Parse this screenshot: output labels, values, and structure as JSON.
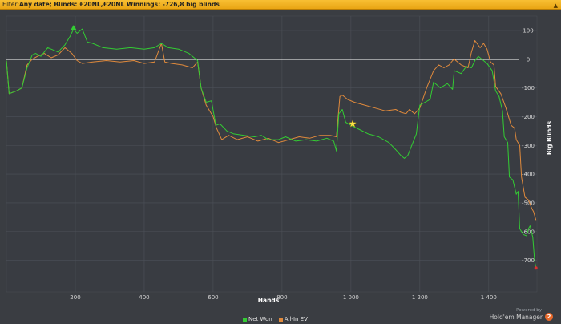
{
  "filter": {
    "prefix": "Filter:",
    "text": "Any date; Blinds: £20NL,£20NL Winnings: -726,8 big blinds"
  },
  "chart_data": {
    "type": "line",
    "title": "",
    "xlabel": "Hands",
    "ylabel": "Big Blinds",
    "xlim": [
      0,
      1540
    ],
    "ylim": [
      -810,
      150
    ],
    "x_ticks": [
      200,
      400,
      600,
      800,
      1000,
      1200,
      1400
    ],
    "x_tick_labels": [
      "200",
      "400",
      "600",
      "800",
      "1 000",
      "1 200",
      "1 400"
    ],
    "y_ticks": [
      100,
      0,
      -100,
      -200,
      -300,
      -400,
      -500,
      -600,
      -700
    ],
    "y_tick_labels": [
      "100",
      "0",
      "-100",
      "-200",
      "-300",
      "-400",
      "-500",
      "-600",
      "-700"
    ],
    "zero_line": 0,
    "grid": true,
    "legend_position": "bottom-center",
    "series": [
      {
        "name": "Net Won",
        "color": "#33cc33",
        "points": [
          [
            0,
            -5
          ],
          [
            8,
            -120
          ],
          [
            30,
            -110
          ],
          [
            45,
            -100
          ],
          [
            60,
            -30
          ],
          [
            75,
            15
          ],
          [
            85,
            20
          ],
          [
            100,
            10
          ],
          [
            120,
            40
          ],
          [
            150,
            25
          ],
          [
            170,
            50
          ],
          [
            185,
            80
          ],
          [
            195,
            105
          ],
          [
            205,
            90
          ],
          [
            220,
            105
          ],
          [
            235,
            60
          ],
          [
            250,
            55
          ],
          [
            280,
            40
          ],
          [
            320,
            35
          ],
          [
            360,
            40
          ],
          [
            400,
            35
          ],
          [
            430,
            40
          ],
          [
            450,
            55
          ],
          [
            470,
            40
          ],
          [
            500,
            35
          ],
          [
            530,
            20
          ],
          [
            555,
            -5
          ],
          [
            565,
            -100
          ],
          [
            580,
            -150
          ],
          [
            595,
            -145
          ],
          [
            608,
            -230
          ],
          [
            620,
            -225
          ],
          [
            640,
            -250
          ],
          [
            660,
            -260
          ],
          [
            690,
            -265
          ],
          [
            720,
            -270
          ],
          [
            740,
            -265
          ],
          [
            760,
            -280
          ],
          [
            790,
            -280
          ],
          [
            810,
            -270
          ],
          [
            840,
            -285
          ],
          [
            870,
            -280
          ],
          [
            900,
            -285
          ],
          [
            930,
            -275
          ],
          [
            950,
            -285
          ],
          [
            958,
            -320
          ],
          [
            965,
            -190
          ],
          [
            975,
            -175
          ],
          [
            985,
            -220
          ],
          [
            1000,
            -230
          ],
          [
            1025,
            -245
          ],
          [
            1050,
            -260
          ],
          [
            1080,
            -270
          ],
          [
            1110,
            -290
          ],
          [
            1130,
            -315
          ],
          [
            1145,
            -335
          ],
          [
            1155,
            -345
          ],
          [
            1165,
            -335
          ],
          [
            1180,
            -290
          ],
          [
            1190,
            -260
          ],
          [
            1200,
            -160
          ],
          [
            1215,
            -150
          ],
          [
            1230,
            -140
          ],
          [
            1240,
            -80
          ],
          [
            1260,
            -100
          ],
          [
            1280,
            -85
          ],
          [
            1295,
            -105
          ],
          [
            1300,
            -40
          ],
          [
            1320,
            -50
          ],
          [
            1335,
            -25
          ],
          [
            1350,
            -30
          ],
          [
            1360,
            -5
          ],
          [
            1370,
            10
          ],
          [
            1380,
            0
          ],
          [
            1395,
            -15
          ],
          [
            1410,
            -40
          ],
          [
            1420,
            -110
          ],
          [
            1430,
            -130
          ],
          [
            1440,
            -180
          ],
          [
            1445,
            -270
          ],
          [
            1455,
            -290
          ],
          [
            1460,
            -410
          ],
          [
            1470,
            -420
          ],
          [
            1480,
            -470
          ],
          [
            1485,
            -460
          ],
          [
            1490,
            -590
          ],
          [
            1495,
            -600
          ],
          [
            1500,
            -610
          ],
          [
            1510,
            -615
          ],
          [
            1515,
            -590
          ],
          [
            1520,
            -580
          ],
          [
            1528,
            -620
          ],
          [
            1533,
            -700
          ],
          [
            1537,
            -727
          ]
        ]
      },
      {
        "name": "All-In EV",
        "color": "#e08a3c",
        "points": [
          [
            0,
            -5
          ],
          [
            8,
            -120
          ],
          [
            30,
            -110
          ],
          [
            45,
            -100
          ],
          [
            60,
            -20
          ],
          [
            75,
            0
          ],
          [
            90,
            10
          ],
          [
            110,
            20
          ],
          [
            130,
            5
          ],
          [
            150,
            15
          ],
          [
            170,
            40
          ],
          [
            190,
            20
          ],
          [
            205,
            -5
          ],
          [
            220,
            -15
          ],
          [
            250,
            -10
          ],
          [
            290,
            -5
          ],
          [
            330,
            -10
          ],
          [
            370,
            -5
          ],
          [
            400,
            -15
          ],
          [
            430,
            -10
          ],
          [
            450,
            55
          ],
          [
            460,
            -10
          ],
          [
            480,
            -15
          ],
          [
            510,
            -20
          ],
          [
            540,
            -30
          ],
          [
            555,
            -10
          ],
          [
            565,
            -100
          ],
          [
            580,
            -160
          ],
          [
            600,
            -200
          ],
          [
            610,
            -240
          ],
          [
            625,
            -280
          ],
          [
            645,
            -265
          ],
          [
            670,
            -280
          ],
          [
            700,
            -270
          ],
          [
            730,
            -285
          ],
          [
            760,
            -275
          ],
          [
            790,
            -290
          ],
          [
            820,
            -280
          ],
          [
            850,
            -270
          ],
          [
            880,
            -275
          ],
          [
            910,
            -265
          ],
          [
            940,
            -265
          ],
          [
            958,
            -270
          ],
          [
            968,
            -130
          ],
          [
            975,
            -125
          ],
          [
            990,
            -140
          ],
          [
            1010,
            -150
          ],
          [
            1040,
            -160
          ],
          [
            1070,
            -170
          ],
          [
            1100,
            -180
          ],
          [
            1130,
            -175
          ],
          [
            1145,
            -185
          ],
          [
            1160,
            -190
          ],
          [
            1170,
            -175
          ],
          [
            1185,
            -190
          ],
          [
            1200,
            -170
          ],
          [
            1220,
            -100
          ],
          [
            1240,
            -40
          ],
          [
            1255,
            -20
          ],
          [
            1270,
            -30
          ],
          [
            1285,
            -20
          ],
          [
            1295,
            -5
          ],
          [
            1300,
            0
          ],
          [
            1320,
            -20
          ],
          [
            1340,
            -30
          ],
          [
            1350,
            25
          ],
          [
            1360,
            65
          ],
          [
            1375,
            40
          ],
          [
            1385,
            55
          ],
          [
            1395,
            35
          ],
          [
            1405,
            -10
          ],
          [
            1415,
            -20
          ],
          [
            1420,
            -95
          ],
          [
            1435,
            -120
          ],
          [
            1450,
            -170
          ],
          [
            1465,
            -230
          ],
          [
            1475,
            -240
          ],
          [
            1480,
            -280
          ],
          [
            1490,
            -300
          ],
          [
            1495,
            -410
          ],
          [
            1505,
            -480
          ],
          [
            1515,
            -490
          ],
          [
            1525,
            -520
          ],
          [
            1530,
            -530
          ],
          [
            1537,
            -560
          ]
        ]
      }
    ],
    "markers": [
      {
        "type": "triangle",
        "x": 195,
        "y": 105,
        "color": "#33cc33"
      },
      {
        "type": "star",
        "x": 1005,
        "y": -225,
        "color": "#ffe34d"
      },
      {
        "type": "dot",
        "x": 1537,
        "y": -727,
        "color": "#e03030"
      }
    ]
  },
  "brand": {
    "powered_by": "Powered by",
    "name": "Hold'em Manager",
    "version": "2"
  }
}
